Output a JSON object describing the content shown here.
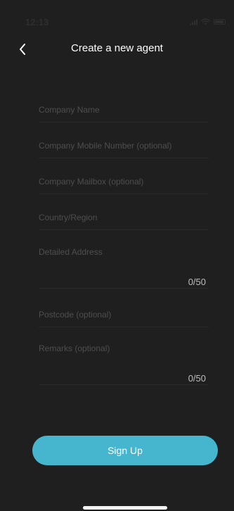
{
  "status_bar": {
    "time": "12:13"
  },
  "header": {
    "title": "Create a new agent",
    "back_icon": "chevron-left-icon"
  },
  "form": {
    "company_name": {
      "value": "",
      "placeholder": "Company Name"
    },
    "mobile_number": {
      "value": "",
      "placeholder": "Company Mobile Number (optional)"
    },
    "mailbox": {
      "value": "",
      "placeholder": "Company Mailbox (optional)"
    },
    "country_region": {
      "value": "",
      "placeholder": "Country/Region"
    },
    "detailed_address": {
      "value": "",
      "placeholder": "Detailed Address",
      "counter": "0/50"
    },
    "postcode": {
      "value": "",
      "placeholder": "Postcode (optional)"
    },
    "remarks": {
      "value": "",
      "placeholder": "Remarks (optional)",
      "counter": "0/50"
    }
  },
  "actions": {
    "signup_label": "Sign Up"
  },
  "colors": {
    "background": "#1f1f1f",
    "accent": "#46b6ce",
    "placeholder": "#4e4e4e"
  }
}
